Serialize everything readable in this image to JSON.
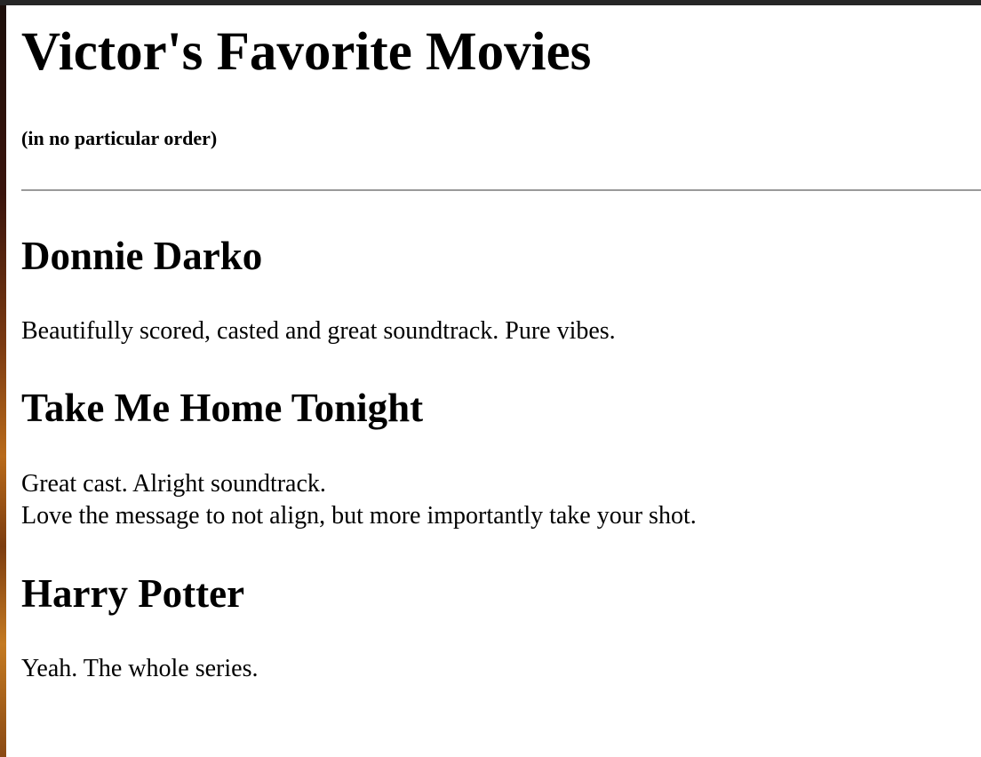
{
  "page": {
    "title": "Victor's Favorite Movies",
    "subtitle": "(in no particular order)"
  },
  "movies": [
    {
      "title": "Donnie Darko",
      "lines": [
        "Beautifully scored, casted and great soundtrack. Pure vibes."
      ]
    },
    {
      "title": "Take Me Home Tonight",
      "lines": [
        "Great cast. Alright soundtrack.",
        "Love the message to not align, but more importantly take your shot."
      ]
    },
    {
      "title": "Harry Potter",
      "lines": [
        "Yeah. The whole series."
      ]
    }
  ]
}
